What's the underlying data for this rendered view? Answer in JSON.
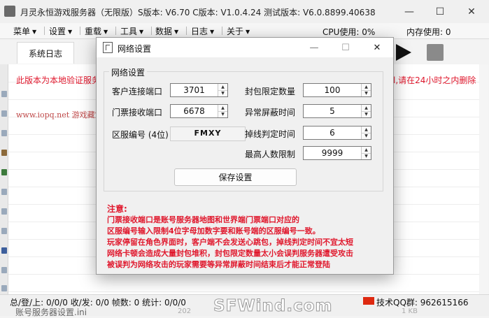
{
  "window": {
    "title": "月灵永恒游戏服务器（无限版）S版本: V6.70 C版本: V1.0.4.24 测试版本: V6.0.8899.40638",
    "controls": [
      "—",
      "☐",
      "✕"
    ]
  },
  "menu": {
    "items": [
      "菜单",
      "设置",
      "重载",
      "工具",
      "数据",
      "日志",
      "关于"
    ],
    "cpu": "CPU使用: 0%",
    "mem": "内存使用: 0"
  },
  "toolbar": {
    "tab_syslog": "系统日志"
  },
  "log": {
    "notice_left": "此版本为本地验证服务",
    "notice_right": "l,请在24小时之内删除",
    "site": "www.iopq.net 游戏藏宝"
  },
  "status": {
    "left": "总/登/上: 0/0/0  收/发: 0/0  帧数: 0  统计: 0/0/0",
    "file": "账号服务器设置.ini",
    "qq": "技术QQ群:  962615166",
    "watermark": "SFWind.com",
    "blur1": "202",
    "blur2": "1 KB"
  },
  "dialog": {
    "title": "网络设置",
    "controls": [
      "—",
      "☐",
      "✕"
    ],
    "group": "网络设置",
    "fields": {
      "client_port": {
        "label": "客户连接端口",
        "value": "3701"
      },
      "ticket_port": {
        "label": "门票接收端口",
        "value": "6678"
      },
      "zone_code": {
        "label": "区服编号 (4位)",
        "value": "FMXY"
      },
      "pkt_limit": {
        "label": "封包限定数量",
        "value": "100"
      },
      "block_time": {
        "label": "异常屏蔽时间",
        "value": "5"
      },
      "disconnect_time": {
        "label": "掉线判定时间",
        "value": "6"
      },
      "max_players": {
        "label": "最高人数限制",
        "value": "9999"
      }
    },
    "save": "保存设置",
    "note_title": "注意:",
    "notes": [
      "门票接收端口是账号服务器地图和世界端门票端口对应的",
      "区服编号输入限制4位字母加数字要和账号端的区服编号一致。",
      "玩家停留在角色界面时，客户端不会发送心跳包，掉线判定时间不宜太短",
      "网络卡顿会造成大量封包堆积，封包限定数量太小会误判服务器遭受攻击",
      "被误判为网络攻击的玩家需要等异常屏蔽时间结束后才能正常登陆"
    ]
  }
}
